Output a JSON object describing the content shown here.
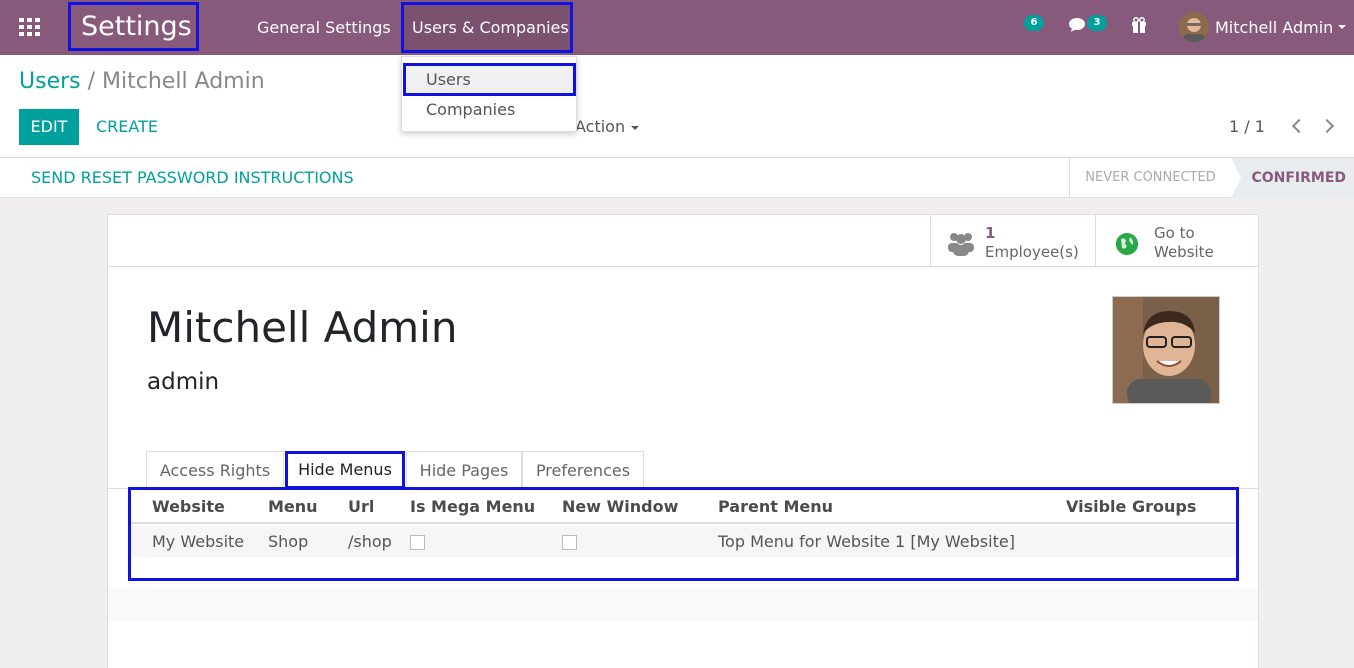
{
  "navbar": {
    "brand": "Settings",
    "menus": [
      "General Settings",
      "Users & Companies"
    ],
    "activity_count": "6",
    "message_count": "3",
    "user_name": "Mitchell Admin"
  },
  "dropdown": {
    "items": [
      "Users",
      "Companies"
    ]
  },
  "control_panel": {
    "breadcrumb_parent": "Users",
    "breadcrumb_sep": "/",
    "breadcrumb_current": "Mitchell Admin",
    "edit_label": "EDIT",
    "create_label": "CREATE",
    "action_label": "Action",
    "pager": "1 / 1"
  },
  "statusbar": {
    "reset_label": "SEND RESET PASSWORD INSTRUCTIONS",
    "stages": [
      "NEVER CONNECTED",
      "CONFIRMED"
    ]
  },
  "sheet": {
    "employee_count": "1",
    "employee_label": "Employee(s)",
    "website_label": "Go to Website",
    "name": "Mitchell Admin",
    "login": "admin"
  },
  "tabs": [
    "Access Rights",
    "Hide Menus",
    "Hide Pages",
    "Preferences"
  ],
  "table": {
    "columns": [
      "Website",
      "Menu",
      "Url",
      "Is Mega Menu",
      "New Window",
      "Parent Menu",
      "Visible Groups"
    ],
    "rows": [
      {
        "website": "My Website",
        "menu": "Shop",
        "url": "/shop",
        "is_mega_menu": false,
        "new_window": false,
        "parent_menu": "Top Menu for Website 1 [My Website]",
        "visible_groups": ""
      }
    ]
  },
  "colors": {
    "navbar": "#875a7b",
    "accent": "#00a09d",
    "highlight_border": "#1212e0"
  }
}
